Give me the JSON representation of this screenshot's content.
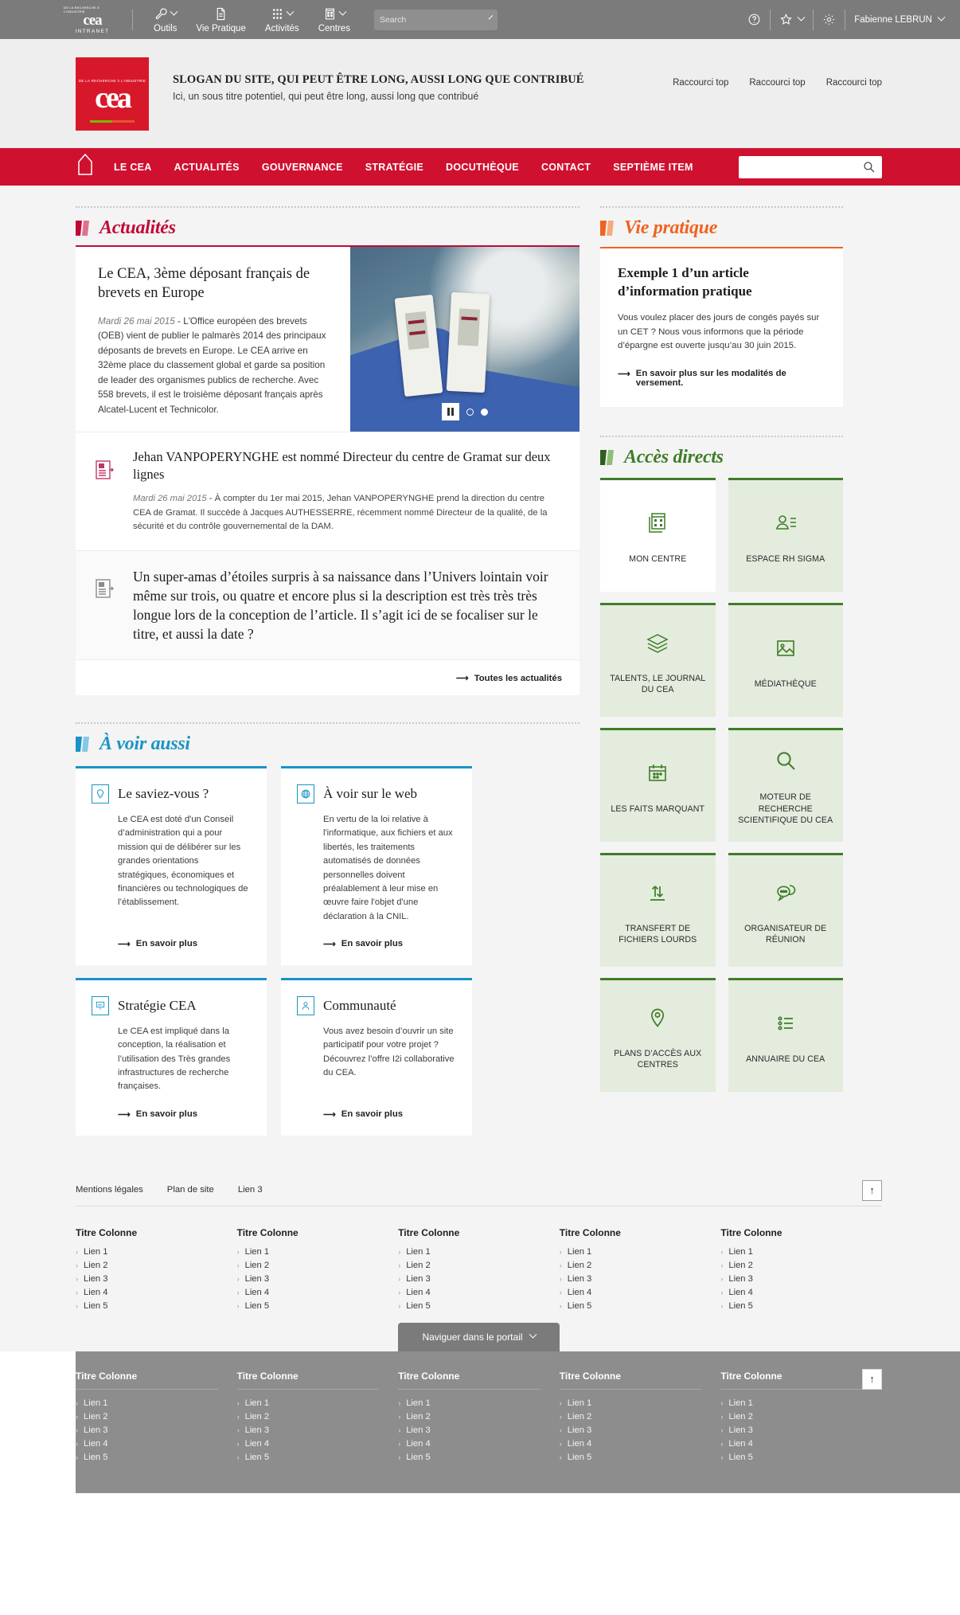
{
  "topbar": {
    "logo": {
      "tagline": "DE LA RECHERCHE À L'INDUSTRIE",
      "word": "cea",
      "sub": "INTRANET"
    },
    "items": [
      {
        "label": "Outils",
        "icon": "wrench-icon"
      },
      {
        "label": "Vie Pratique",
        "icon": "document-icon"
      },
      {
        "label": "Activités",
        "icon": "grid-dots-icon"
      },
      {
        "label": "Centres",
        "icon": "building-icon"
      }
    ],
    "search": {
      "placeholder": "Search",
      "value": ""
    },
    "help_icon": "help-circle-icon",
    "favorites_icon": "star-icon",
    "settings_icon": "gear-icon",
    "user": "Fabienne LEBRUN"
  },
  "header": {
    "brand": {
      "tagline": "DE LA RECHERCHE À L'INDUSTRIE",
      "word": "cea"
    },
    "slogan": "SLOGAN DU SITE, QUI PEUT ÊTRE LONG, AUSSI LONG QUE CONTRIBUÉ",
    "subtitle": "Ici, un sous titre potentiel, qui peut être long, aussi long que contribué",
    "shortcuts": [
      "Raccourci top",
      "Raccourci top",
      "Raccourci top"
    ]
  },
  "nav": {
    "home_icon": "home-arrow-icon",
    "items": [
      "LE CEA",
      "ACTUALITÉS",
      "GOUVERNANCE",
      "STRATÉGIE",
      "DOCUTHÈQUE",
      "CONTACT",
      "SEPTIÈME ITEM"
    ],
    "search": {
      "placeholder": "",
      "value": ""
    }
  },
  "actualites": {
    "section_title": "Actualités",
    "accent": "#c00a36",
    "featured": {
      "title": "Le CEA, 3ème  déposant français de brevets en Europe",
      "date": "Mardi 26 mai 2015",
      "separator": " - ",
      "body": "L'Office européen des brevets (OEB) vient de publier le palmarès 2014 des principaux déposants de  brevets en Europe. Le CEA arrive en 32ème  place du classement global et garde sa position de leader des organismes publics de recherche. Avec 558 brevets, il est le troisième déposant français après Alcatel-Lucent et Technicolor.",
      "carousel": {
        "pause_label": "pause",
        "dots": 2,
        "active_dot": 1
      }
    },
    "items": [
      {
        "icon": "article-red-icon",
        "title": "Jehan VANPOPERYNGHE est nommé Directeur du centre de Gramat sur deux lignes",
        "date": "Mardi 26 mai 2015",
        "separator": " - ",
        "body": "À compter du 1er mai 2015, Jehan VANPOPERYNGHE prend la direction du centre CEA de Gramat. Il succède à Jacques AUTHESSERRE, récemment nommé Directeur de la qualité, de la sécurité et du contrôle gouvernemental de la DAM."
      },
      {
        "icon": "article-grey-icon",
        "title": "Un super-amas d’étoiles surpris à sa naissance dans l’Univers lointain voir même sur trois, ou quatre et encore plus si la description est très très très longue lors de la conception de l’article. Il s’agit ici de se focaliser sur le titre, et aussi la date ?",
        "date": "",
        "separator": "",
        "body": ""
      }
    ],
    "more_label": "Toutes les actualités"
  },
  "avoir_aussi": {
    "section_title": "À voir aussi",
    "accent": "#1a93c6",
    "cards": [
      {
        "icon": "lightbulb-icon",
        "title": "Le saviez-vous ?",
        "body": "Le CEA est  doté d'un Conseil d’administration qui a pour mission qui de délibérer sur les grandes orientations stratégiques, économiques et financières ou technologiques de l’établissement.",
        "link": "En savoir plus"
      },
      {
        "icon": "globe-icon",
        "title": "À voir sur le web",
        "body": "En vertu de la loi relative à l'informatique, aux fichiers et aux libertés, les traitements automatisés de données personnelles doivent préalablement à leur mise en œuvre faire l'objet d'une déclaration à la CNIL.",
        "link": "En savoir plus"
      },
      {
        "icon": "presentation-icon",
        "title": "Stratégie CEA",
        "body": "Le CEA est impliqué dans la conception, la réalisation et l’utilisation des Très grandes infrastructures de recherche françaises.",
        "link": "En savoir plus"
      },
      {
        "icon": "user-lock-icon",
        "title": "Communauté",
        "body": "Vous avez besoin d’ouvrir un site participatif pour votre projet ? Découvrez l’offre I2i collaborative du CEA.",
        "link": "En savoir plus"
      }
    ]
  },
  "vie_pratique": {
    "section_title": "Vie pratique",
    "accent": "#ee6320",
    "title": "Exemple 1 d’un article d’information pratique",
    "body": "Vous voulez placer des jours de congés payés sur un CET ? Nous vous informons que la période d’épargne est ouverte jusqu’au 30 juin 2015.",
    "link": "En savoir plus sur les modalités de versement."
  },
  "acces_directs": {
    "section_title": "Accès directs",
    "accent": "#3f7d28",
    "tiles": [
      {
        "label": "MON CENTRE",
        "icon": "buildings-icon",
        "highlight": true
      },
      {
        "label": "ESPACE RH SIGMA",
        "icon": "person-list-icon",
        "highlight": false
      },
      {
        "label": "TALENTS, LE JOURNAL DU CEA",
        "icon": "layers-icon",
        "highlight": false
      },
      {
        "label": "MÉDIATHÈQUE",
        "icon": "image-icon",
        "highlight": false
      },
      {
        "label": "LES FAITS MARQUANT",
        "icon": "calendar-icon",
        "highlight": false
      },
      {
        "label": "MOTEUR DE RECHERCHE SCIENTIFIQUE DU CEA",
        "icon": "magnifier-icon",
        "highlight": false
      },
      {
        "label": "TRANSFERT DE FICHIERS LOURDS",
        "icon": "transfer-icon",
        "highlight": false
      },
      {
        "label": "ORGANISATEUR DE RÉUNION",
        "icon": "chat-bubbles-icon",
        "highlight": false
      },
      {
        "label": "PLANS D’ACCÈS AUX CENTRES",
        "icon": "map-pin-icon",
        "highlight": false
      },
      {
        "label": "ANNUAIRE DU CEA",
        "icon": "list-icon",
        "highlight": false
      }
    ]
  },
  "footer": {
    "links": [
      "Mentions légales",
      "Plan de site",
      "Lien 3"
    ],
    "to_top_icon": "arrow-up-icon",
    "columns": [
      {
        "title": "Titre Colonne",
        "links": [
          "Lien 1",
          "Lien 2",
          "Lien 3",
          "Lien 4",
          "Lien 5"
        ]
      },
      {
        "title": "Titre Colonne",
        "links": [
          "Lien 1",
          "Lien 2",
          "Lien 3",
          "Lien 4",
          "Lien 5"
        ]
      },
      {
        "title": "Titre Colonne",
        "links": [
          "Lien 1",
          "Lien 2",
          "Lien 3",
          "Lien 4",
          "Lien 5"
        ]
      },
      {
        "title": "Titre Colonne",
        "links": [
          "Lien 1",
          "Lien 2",
          "Lien 3",
          "Lien 4",
          "Lien 5"
        ]
      },
      {
        "title": "Titre Colonne",
        "links": [
          "Lien 1",
          "Lien 2",
          "Lien 3",
          "Lien 4",
          "Lien 5"
        ]
      }
    ],
    "portal_button": "Naviguer dans le portail",
    "bottom_columns": [
      {
        "title": "Titre Colonne",
        "links": [
          "Lien 1",
          "Lien 2",
          "Lien 3",
          "Lien 4",
          "Lien 5"
        ]
      },
      {
        "title": "Titre Colonne",
        "links": [
          "Lien 1",
          "Lien 2",
          "Lien 3",
          "Lien 4",
          "Lien 5"
        ]
      },
      {
        "title": "Titre Colonne",
        "links": [
          "Lien 1",
          "Lien 2",
          "Lien 3",
          "Lien 4",
          "Lien 5"
        ]
      },
      {
        "title": "Titre Colonne",
        "links": [
          "Lien 1",
          "Lien 2",
          "Lien 3",
          "Lien 4",
          "Lien 5"
        ]
      },
      {
        "title": "Titre Colonne",
        "links": [
          "Lien 1",
          "Lien 2",
          "Lien 3",
          "Lien 4",
          "Lien 5"
        ]
      }
    ]
  }
}
